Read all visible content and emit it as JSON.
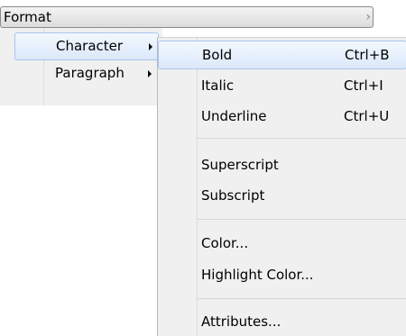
{
  "format_menu": {
    "label": "Format",
    "arrow": "›"
  },
  "submenu_level1": {
    "items": [
      {
        "label": "Character",
        "has_submenu": true,
        "highlighted": true
      },
      {
        "label": "Paragraph",
        "has_submenu": true,
        "highlighted": false
      }
    ]
  },
  "character_submenu": {
    "items": [
      {
        "label": "Bold",
        "shortcut": "Ctrl+B",
        "highlighted": true
      },
      {
        "label": "Italic",
        "shortcut": "Ctrl+I"
      },
      {
        "label": "Underline",
        "shortcut": "Ctrl+U"
      },
      {
        "label": "Superscript",
        "shortcut": ""
      },
      {
        "label": "Subscript",
        "shortcut": ""
      },
      {
        "label": "Color...",
        "shortcut": ""
      },
      {
        "label": "Highlight Color...",
        "shortcut": ""
      },
      {
        "label": "Attributes...",
        "shortcut": ""
      }
    ]
  },
  "colors": {
    "menu_background": "#f0f0f0",
    "highlight_border": "#a8c6ee",
    "highlight_fill": "#dbe8fa"
  }
}
